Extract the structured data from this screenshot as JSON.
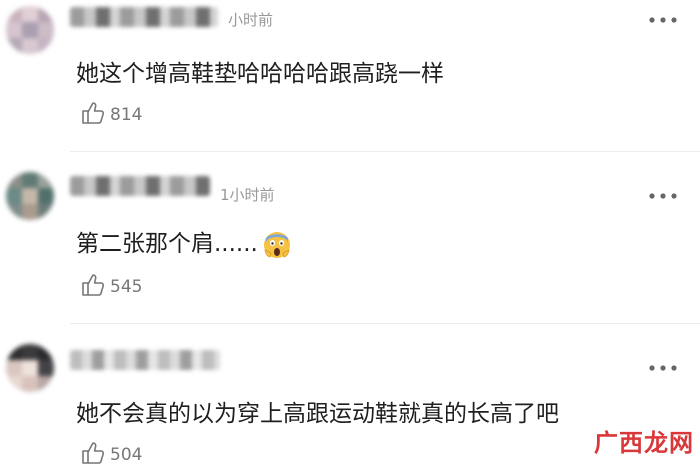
{
  "comments": [
    {
      "time": "小时前",
      "text": "她这个增高鞋垫哈哈哈哈跟高跷一样",
      "likes": "814",
      "more_icon": "more-dots-icon",
      "like_icon": "thumbs-up-icon"
    },
    {
      "time": "1小时前",
      "text": "第二张那个肩......",
      "emoji": "scream-face-emoji",
      "likes": "545",
      "more_icon": "more-dots-icon",
      "like_icon": "thumbs-up-icon"
    },
    {
      "time": "",
      "text": "她不会真的以为穿上高跟运动鞋就真的长高了吧",
      "likes": "504",
      "more_icon": "more-dots-icon",
      "like_icon": "thumbs-up-icon"
    }
  ],
  "watermark": "广西龙网",
  "colors": {
    "time_gray": "#999999",
    "like_gray": "#777777",
    "watermark_red": "#d9383a"
  }
}
